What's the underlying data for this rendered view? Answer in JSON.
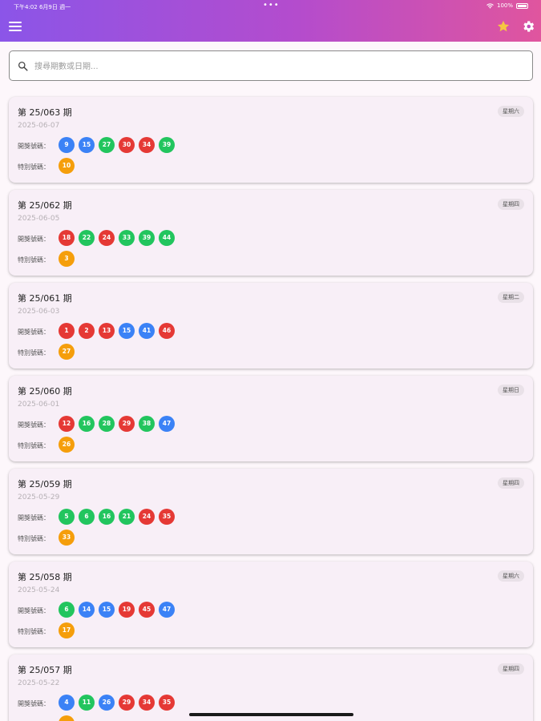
{
  "status_bar": {
    "time": "下午4:02",
    "date": "6月9日 週一",
    "battery": "100%"
  },
  "header": {
    "menu_icon": "menu-icon",
    "favorite_icon": "star-icon",
    "settings_icon": "gear-icon",
    "star_color": "#f5c542"
  },
  "search": {
    "placeholder": "搜尋期數或日期...",
    "value": "",
    "icon": "search-icon"
  },
  "labels": {
    "main_numbers": "開獎號碼：",
    "special_number": "特別號碼："
  },
  "colors": {
    "red": "#e53935",
    "blue": "#3b82f6",
    "green": "#22c55e",
    "special": "#f59e0b"
  },
  "draws": [
    {
      "title": "第 25/063 期",
      "date": "2025-06-07",
      "weekday": "星期六",
      "numbers": [
        {
          "value": "9",
          "color": "blue"
        },
        {
          "value": "15",
          "color": "blue"
        },
        {
          "value": "27",
          "color": "green"
        },
        {
          "value": "30",
          "color": "red"
        },
        {
          "value": "34",
          "color": "red"
        },
        {
          "value": "39",
          "color": "green"
        }
      ],
      "special": "10"
    },
    {
      "title": "第 25/062 期",
      "date": "2025-06-05",
      "weekday": "星期四",
      "numbers": [
        {
          "value": "18",
          "color": "red"
        },
        {
          "value": "22",
          "color": "green"
        },
        {
          "value": "24",
          "color": "red"
        },
        {
          "value": "33",
          "color": "green"
        },
        {
          "value": "39",
          "color": "green"
        },
        {
          "value": "44",
          "color": "green"
        }
      ],
      "special": "3"
    },
    {
      "title": "第 25/061 期",
      "date": "2025-06-03",
      "weekday": "星期二",
      "numbers": [
        {
          "value": "1",
          "color": "red"
        },
        {
          "value": "2",
          "color": "red"
        },
        {
          "value": "13",
          "color": "red"
        },
        {
          "value": "15",
          "color": "blue"
        },
        {
          "value": "41",
          "color": "blue"
        },
        {
          "value": "46",
          "color": "red"
        }
      ],
      "special": "27"
    },
    {
      "title": "第 25/060 期",
      "date": "2025-06-01",
      "weekday": "星期日",
      "numbers": [
        {
          "value": "12",
          "color": "red"
        },
        {
          "value": "16",
          "color": "green"
        },
        {
          "value": "28",
          "color": "green"
        },
        {
          "value": "29",
          "color": "red"
        },
        {
          "value": "38",
          "color": "green"
        },
        {
          "value": "47",
          "color": "blue"
        }
      ],
      "special": "26"
    },
    {
      "title": "第 25/059 期",
      "date": "2025-05-29",
      "weekday": "星期四",
      "numbers": [
        {
          "value": "5",
          "color": "green"
        },
        {
          "value": "6",
          "color": "green"
        },
        {
          "value": "16",
          "color": "green"
        },
        {
          "value": "21",
          "color": "green"
        },
        {
          "value": "24",
          "color": "red"
        },
        {
          "value": "35",
          "color": "red"
        }
      ],
      "special": "33"
    },
    {
      "title": "第 25/058 期",
      "date": "2025-05-24",
      "weekday": "星期六",
      "numbers": [
        {
          "value": "6",
          "color": "green"
        },
        {
          "value": "14",
          "color": "blue"
        },
        {
          "value": "15",
          "color": "blue"
        },
        {
          "value": "19",
          "color": "red"
        },
        {
          "value": "45",
          "color": "red"
        },
        {
          "value": "47",
          "color": "blue"
        }
      ],
      "special": "17"
    },
    {
      "title": "第 25/057 期",
      "date": "2025-05-22",
      "weekday": "星期四",
      "numbers": [
        {
          "value": "4",
          "color": "blue"
        },
        {
          "value": "11",
          "color": "green"
        },
        {
          "value": "26",
          "color": "blue"
        },
        {
          "value": "29",
          "color": "red"
        },
        {
          "value": "34",
          "color": "red"
        },
        {
          "value": "35",
          "color": "red"
        }
      ],
      "special": ""
    }
  ]
}
